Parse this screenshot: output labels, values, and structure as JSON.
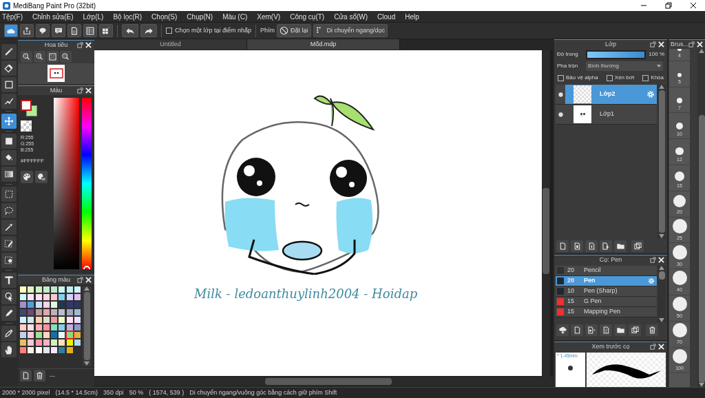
{
  "window": {
    "title": "MediBang Paint Pro (32bit)"
  },
  "menu": [
    "Tệp(F)",
    "Chỉnh sửa(E)",
    "Lớp(L)",
    "Bộ lọc(R)",
    "Chọn(S)",
    "Chụp(N)",
    "Màu (C)",
    "Xem(V)",
    "Công cụ(T)",
    "Cửa sổ(W)",
    "Cloud",
    "Help"
  ],
  "toolbar": {
    "pick_layer": {
      "label": "Chọn một lớp tại điểm nhấp",
      "checked": false
    },
    "keys_label": "Phím",
    "reset_button": "Đặt lại",
    "move_button": "Di chuyển ngang/dọc"
  },
  "tools": [
    {
      "selected": false
    },
    {
      "selected": false
    },
    {
      "selected": false
    },
    {
      "selected": false
    },
    {
      "selected": true
    },
    {
      "selected": false
    },
    {
      "selected": false
    },
    {
      "selected": false
    },
    {
      "selected": false
    },
    {
      "selected": false
    },
    {
      "selected": false
    },
    {
      "selected": false
    },
    {
      "selected": false
    },
    {
      "selected": false
    },
    {
      "selected": false
    },
    {
      "selected": false
    },
    {
      "selected": false
    },
    {
      "selected": false
    }
  ],
  "navigator": {
    "title": "Hoa tiêu"
  },
  "color_panel": {
    "title": "Màu",
    "hue": {
      "level": 0
    },
    "rgb": [
      "R:255",
      "G:255",
      "B:255"
    ],
    "hex": "#FFFFFF"
  },
  "palette": {
    "title": "Bảng màu",
    "footer": "---",
    "swatches": [
      {
        "color": "#fffcc0",
        "selected": false
      },
      {
        "color": "#e0f5c0",
        "selected": false
      },
      {
        "color": "#d0f0c0",
        "selected": false
      },
      {
        "color": "#c0ecc8",
        "selected": false
      },
      {
        "color": "#c0e8d0",
        "selected": false
      },
      {
        "color": "#c8f8f0",
        "selected": false
      },
      {
        "color": "#c0f0f0",
        "selected": false
      },
      {
        "color": "#d0f4ff",
        "selected": false
      },
      {
        "color": "#d0f8ff",
        "selected": false
      },
      {
        "color": "#f8e8ff",
        "selected": false
      },
      {
        "color": "#ffe0f8",
        "selected": false
      },
      {
        "color": "#ffd8e0",
        "selected": false
      },
      {
        "color": "#ffc8d0",
        "selected": false
      },
      {
        "color": "#80d0f0",
        "selected": false
      },
      {
        "color": "#d8d0ff",
        "selected": false
      },
      {
        "color": "#e0c0f0",
        "selected": false
      },
      {
        "color": "#a090d0",
        "selected": false
      },
      {
        "color": "#50a0e0",
        "selected": false
      },
      {
        "color": "#c8e0ff",
        "selected": false
      },
      {
        "color": "#ffd0e8",
        "selected": false
      },
      {
        "color": "#e0f8e0",
        "selected": false
      },
      {
        "color": "#203850",
        "selected": false
      },
      {
        "color": "#303870",
        "selected": false
      },
      {
        "color": "#283860",
        "selected": false
      },
      {
        "color": "#404870",
        "selected": false
      },
      {
        "color": "#704870",
        "selected": false
      },
      {
        "color": "#c098a0",
        "selected": false
      },
      {
        "color": "#e0a8a8",
        "selected": false
      },
      {
        "color": "#c0b0b8",
        "selected": false
      },
      {
        "color": "#b8c0d0",
        "selected": false
      },
      {
        "color": "#a0a8c0",
        "selected": false
      },
      {
        "color": "#a0b8d0",
        "selected": false
      },
      {
        "color": "#d0f0ff",
        "selected": false
      },
      {
        "color": "#d0e8f0",
        "selected": false
      },
      {
        "color": "#ffd0b0",
        "selected": false
      },
      {
        "color": "#e0e0d0",
        "selected": false
      },
      {
        "color": "#e8a0a0",
        "selected": false
      },
      {
        "color": "#f0f8d0",
        "selected": false
      },
      {
        "color": "#ffe0f8",
        "selected": false
      },
      {
        "color": "#f0e0ff",
        "selected": false
      },
      {
        "color": "#ffd0c0",
        "selected": false
      },
      {
        "color": "#ffe0e0",
        "selected": false
      },
      {
        "color": "#ffb0b8",
        "selected": false
      },
      {
        "color": "#ff90a0",
        "selected": false
      },
      {
        "color": "#80e0c0",
        "selected": false
      },
      {
        "color": "#80d0f0",
        "selected": false
      },
      {
        "color": "#c0b0e0",
        "selected": false
      },
      {
        "color": "#9098c8",
        "selected": false
      },
      {
        "color": "#c0d0f0",
        "selected": false
      },
      {
        "color": "#ffc8e0",
        "selected": false
      },
      {
        "color": "#a0e090",
        "selected": false
      },
      {
        "color": "#ffd8c0",
        "selected": false
      },
      {
        "color": "#1070b0",
        "selected": false
      },
      {
        "color": "#e8f8ff",
        "selected": false
      },
      {
        "color": "#80e080",
        "selected": true
      },
      {
        "color": "#e8b040",
        "selected": false
      },
      {
        "color": "#e8c060",
        "selected": false
      },
      {
        "color": "#ffc8d0",
        "selected": false
      },
      {
        "color": "#ff98a8",
        "selected": false
      },
      {
        "color": "#ffb0c0",
        "selected": false
      },
      {
        "color": "#d0f0c0",
        "selected": false
      },
      {
        "color": "#ffe0c0",
        "selected": false
      },
      {
        "color": "#f0f000",
        "selected": false
      },
      {
        "color": "#b0d8f0",
        "selected": false
      },
      {
        "color": "#ff8080",
        "selected": false
      },
      {
        "color": "#f8f0e0",
        "selected": false
      },
      {
        "color": "#ffffff",
        "selected": false
      },
      {
        "color": "#e0e8f0",
        "selected": false
      },
      {
        "color": "#f8e8ff",
        "selected": false
      },
      {
        "color": "#3080a0",
        "selected": false
      },
      {
        "color": "#e8b020",
        "selected": false
      }
    ]
  },
  "document_tabs": [
    {
      "label": "Untitled",
      "selected": false
    },
    {
      "label": "Mốd.mdp",
      "selected": true
    }
  ],
  "canvas": {
    "signature": "Milk - ledoanthuylinh2004 - Hoidap"
  },
  "layers_panel": {
    "title": "Lớp",
    "opacity_label": "Độ trong",
    "opacity": {
      "level": 1
    },
    "opacity_reading": "100 %",
    "blend_label": "Pha trộn",
    "blend_value": "Bình thường",
    "options": [
      {
        "label": "Bảo vệ alpha",
        "checked": false
      },
      {
        "label": "Xén bớt",
        "checked": false
      },
      {
        "label": "Khóa",
        "checked": false
      }
    ],
    "layers": [
      {
        "name": "Lớp2",
        "selected": true,
        "kind": "transparent"
      },
      {
        "name": "Lớp1",
        "selected": false,
        "kind": "drawing"
      }
    ]
  },
  "brush_panel": {
    "title": "Cọ: Pen",
    "brushes": [
      {
        "color": "#303030",
        "size": "20",
        "name": "Pencil",
        "selected": false
      },
      {
        "color": "#202830",
        "size": "20",
        "name": "Pen",
        "selected": true
      },
      {
        "color": "#202830",
        "size": "10",
        "name": "Pen (Sharp)",
        "selected": false
      },
      {
        "color": "#f03030",
        "size": "15",
        "name": "G Pen",
        "selected": false
      },
      {
        "color": "#f03030",
        "size": "15",
        "name": "Mapping Pen",
        "selected": false
      }
    ]
  },
  "brush_preview": {
    "title": "Xem trước cọ",
    "size": "* 1.45mm"
  },
  "brush_sizes": {
    "title": "Brus...",
    "sizes": [
      "4",
      "5",
      "7",
      "10",
      "12",
      "15",
      "20",
      "25",
      "30",
      "40",
      "50",
      "70",
      "100"
    ]
  },
  "status_bar": [
    "2000 * 2000 pixel",
    "(14.5 * 14.5cm)",
    "350 dpi",
    "50 %",
    "( 1574, 539 )",
    "Di chuyển ngang/vuông góc bằng cách giữ phím Shift"
  ]
}
